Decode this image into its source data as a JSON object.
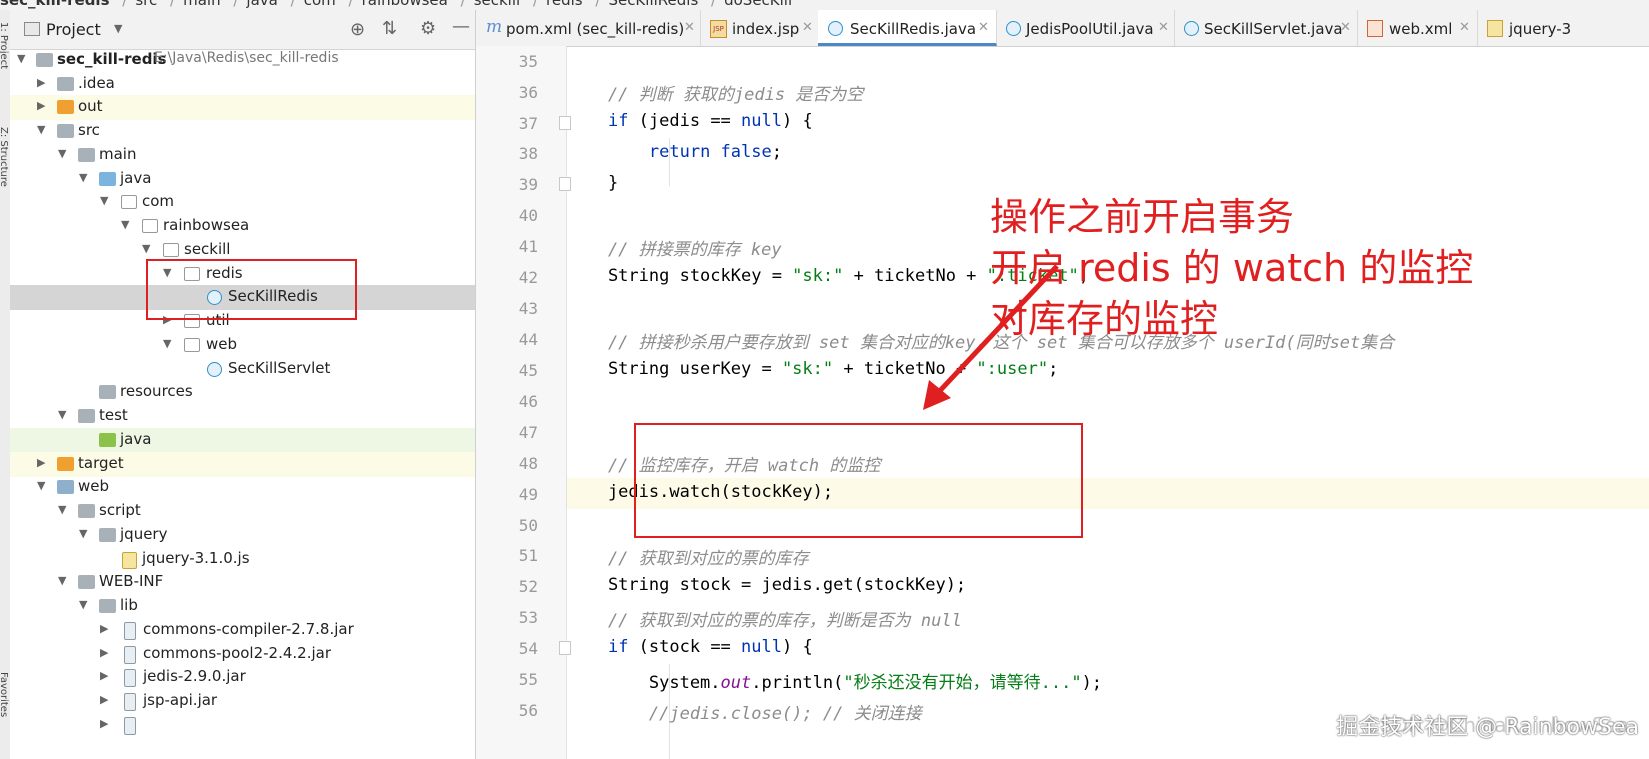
{
  "breadcrumb": [
    "sec_kill-redis",
    "src",
    "main",
    "java",
    "com",
    "rainbowsea",
    "seckill",
    "redis",
    "SecKillRedis",
    "doSecKill"
  ],
  "side_strip": {
    "project_label": "1: Project",
    "structure_label": "Z: Structure",
    "favorites_label": "Favorites"
  },
  "project_panel": {
    "title": "Project",
    "tree": [
      {
        "label": "sec_kill-redis",
        "path": "E:\\Java\\Redis\\sec_kill-redis",
        "icon": "module-folder-icon"
      },
      {
        "label": ".idea",
        "icon": "folder-icon"
      },
      {
        "label": "out",
        "icon": "folder-orange-icon"
      },
      {
        "label": "src",
        "icon": "folder-icon"
      },
      {
        "label": "main",
        "icon": "folder-icon"
      },
      {
        "label": "java",
        "icon": "source-folder-icon"
      },
      {
        "label": "com",
        "icon": "package-icon"
      },
      {
        "label": "rainbowsea",
        "icon": "package-icon"
      },
      {
        "label": "seckill",
        "icon": "package-icon"
      },
      {
        "label": "redis",
        "icon": "package-icon"
      },
      {
        "label": "SecKillRedis",
        "icon": "java-class-icon"
      },
      {
        "label": "util",
        "icon": "package-icon"
      },
      {
        "label": "web",
        "icon": "package-icon"
      },
      {
        "label": "SecKillServlet",
        "icon": "java-class-icon"
      },
      {
        "label": "resources",
        "icon": "resources-folder-icon"
      },
      {
        "label": "test",
        "icon": "folder-icon"
      },
      {
        "label": "java",
        "icon": "test-folder-icon"
      },
      {
        "label": "target",
        "icon": "folder-orange-icon"
      },
      {
        "label": "web",
        "icon": "web-folder-icon"
      },
      {
        "label": "script",
        "icon": "folder-icon"
      },
      {
        "label": "jquery",
        "icon": "folder-icon"
      },
      {
        "label": "jquery-3.1.0.js",
        "icon": "js-file-icon"
      },
      {
        "label": "WEB-INF",
        "icon": "folder-icon"
      },
      {
        "label": "lib",
        "icon": "folder-icon"
      },
      {
        "label": "commons-compiler-2.7.8.jar",
        "icon": "jar-icon"
      },
      {
        "label": "commons-pool2-2.4.2.jar",
        "icon": "jar-icon"
      },
      {
        "label": "jedis-2.9.0.jar",
        "icon": "jar-icon"
      },
      {
        "label": "jsp-api.jar",
        "icon": "jar-icon"
      }
    ]
  },
  "tabs": [
    {
      "label": "pom.xml (sec_kill-redis)",
      "icon": "maven-icon"
    },
    {
      "label": "index.jsp",
      "icon": "jsp-icon"
    },
    {
      "label": "SecKillRedis.java",
      "icon": "java-class-icon",
      "active": true
    },
    {
      "label": "JedisPoolUtil.java",
      "icon": "java-class-icon"
    },
    {
      "label": "SecKillServlet.java",
      "icon": "java-class-icon"
    },
    {
      "label": "web.xml",
      "icon": "xml-icon"
    },
    {
      "label": "jquery-3",
      "icon": "js-file-icon"
    }
  ],
  "code": {
    "line_numbers": [
      "35",
      "36",
      "37",
      "38",
      "39",
      "40",
      "41",
      "42",
      "43",
      "44",
      "45",
      "46",
      "47",
      "48",
      "49",
      "50",
      "51",
      "52",
      "53",
      "54",
      "55",
      "56"
    ],
    "lines": [
      {
        "t": ""
      },
      {
        "t": "    // 判断 获取的jedis 是否为空"
      },
      {
        "t": "    if (jedis == null) {"
      },
      {
        "t": "        return false;"
      },
      {
        "t": "    }"
      },
      {
        "t": ""
      },
      {
        "t": "    // 拼接票的库存 key"
      },
      {
        "t": "    String stockKey = \"sk:\" + ticketNo + \":ticket\";"
      },
      {
        "t": ""
      },
      {
        "t": "    // 拼接秒杀用户要存放到 set 集合对应的key，这个 set 集合可以存放多个 userId(同时set集合"
      },
      {
        "t": "    String userKey = \"sk:\" + ticketNo + \":user\";"
      },
      {
        "t": ""
      },
      {
        "t": ""
      },
      {
        "t": "    // 监控库存，开启 watch 的监控"
      },
      {
        "t": "    jedis.watch(stockKey);"
      },
      {
        "t": ""
      },
      {
        "t": "    // 获取到对应的票的库存"
      },
      {
        "t": "    String stock = jedis.get(stockKey);"
      },
      {
        "t": "    // 获取到对应的票的库存，判断是否为 null"
      },
      {
        "t": "    if (stock == null) {"
      },
      {
        "t": "        System.out.println(\"秒杀还没有开始，请等待...\");"
      },
      {
        "t": "        //jedis.close(); // 关闭连接"
      }
    ]
  },
  "annotation": {
    "line1": "操作之前开启事务",
    "line2": "开启 redis 的 watch 的监控",
    "line3": "对库存的监控"
  },
  "watermark": "掘金技术社区 @ RainbowSea",
  "watermark_under": "CSDN @ChinaRainbowSea"
}
